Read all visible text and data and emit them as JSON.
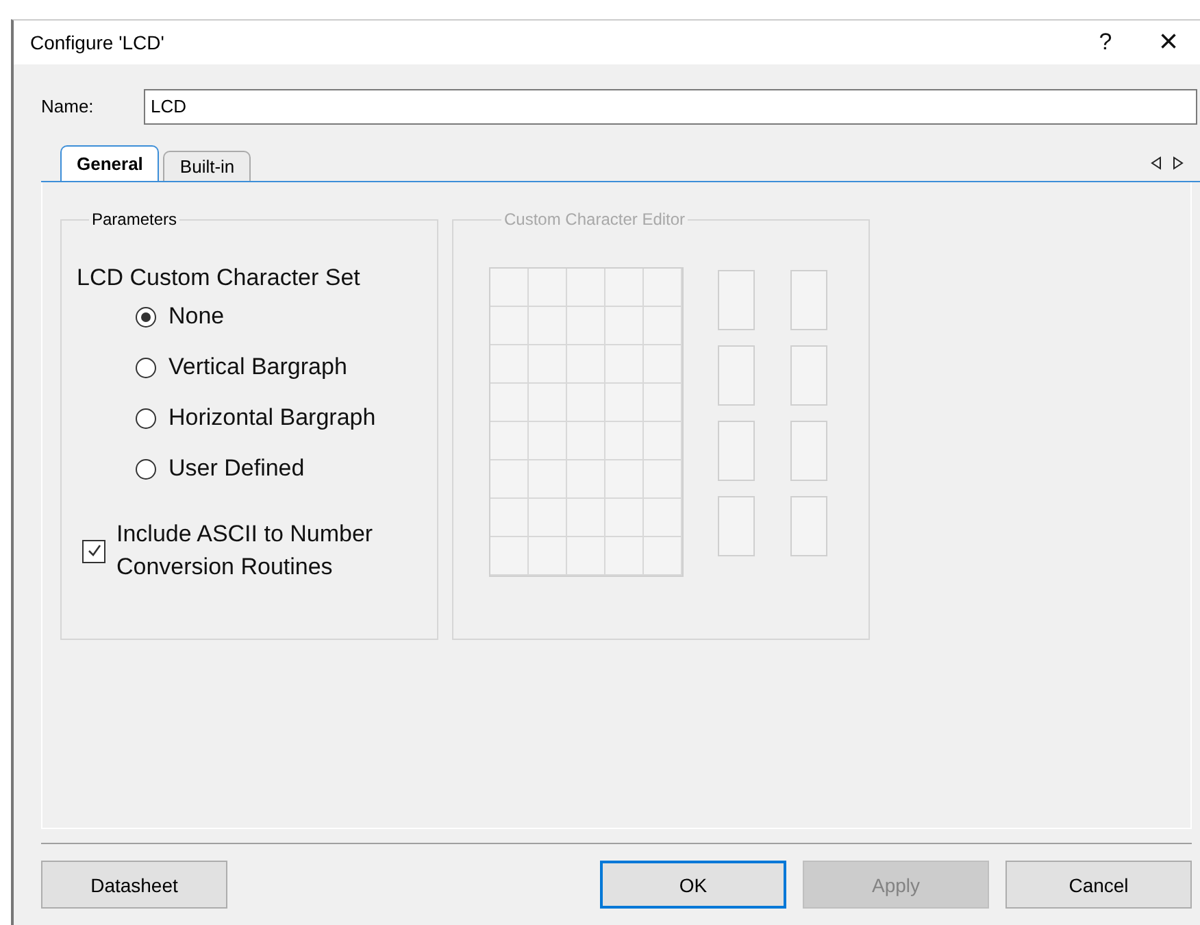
{
  "window": {
    "title": "Configure 'LCD'",
    "help": "?",
    "close": "×"
  },
  "name_field": {
    "label": "Name:",
    "value": "LCD"
  },
  "tabs": [
    {
      "label": "General",
      "selected": true
    },
    {
      "label": "Built-in",
      "selected": false
    }
  ],
  "parameters": {
    "title": "Parameters",
    "heading": "LCD Custom Character Set",
    "options": [
      {
        "label": "None",
        "selected": true
      },
      {
        "label": "Vertical Bargraph",
        "selected": false
      },
      {
        "label": "Horizontal Bargraph",
        "selected": false
      },
      {
        "label": "User Defined",
        "selected": false
      }
    ],
    "checkbox": {
      "label": "Include ASCII to Number Conversion Routines",
      "checked": true
    }
  },
  "editor": {
    "title": "Custom Character Editor",
    "disabled": true
  },
  "buttons": [
    {
      "label": "Datasheet",
      "default": false,
      "disabled": false
    },
    {
      "label": "OK",
      "default": true,
      "disabled": false
    },
    {
      "label": "Apply",
      "default": false,
      "disabled": true
    },
    {
      "label": "Cancel",
      "default": false,
      "disabled": false
    }
  ]
}
